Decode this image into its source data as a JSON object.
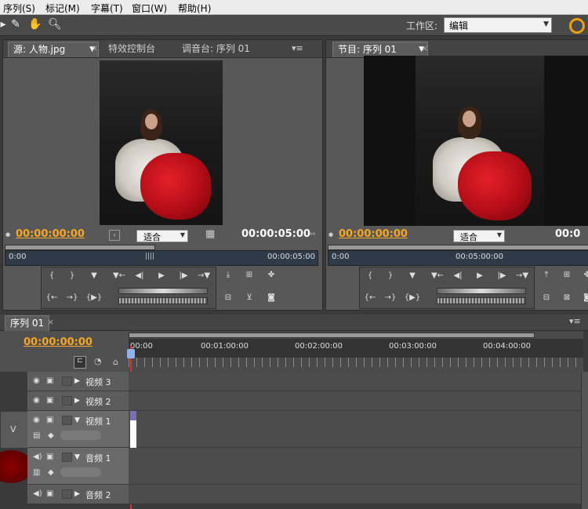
{
  "menu": [
    "序列(S)",
    "标记(M)",
    "字幕(T)",
    "窗口(W)",
    "帮助(H)"
  ],
  "toolbar": {
    "tools": [
      "select-arrow-icon",
      "pen-icon",
      "hand-icon",
      "zoom-icon"
    ],
    "workspace_label": "工作区:",
    "workspace_value": "编辑"
  },
  "source_panel": {
    "tabs": [
      "源: 人物.jpg",
      "特效控制台",
      "调音台: 序列 01"
    ],
    "timecode_left": "00:00:00:00",
    "fit": "适合",
    "timecode_right": "00:00:05:00",
    "ruler_start": "0:00",
    "ruler_end": "00:00:05:00"
  },
  "program_panel": {
    "tab": "节目: 序列 01",
    "timecode_left": "00:00:00:00",
    "fit": "适合",
    "timecode_right": "00:0",
    "ruler_start": "0:00",
    "ruler_mid": "00:05:00:00"
  },
  "timeline": {
    "tab": "序列 01",
    "timecode": "00:00:00:00",
    "ruler_labels": [
      "00:00",
      "00:01:00:00",
      "00:02:00:00",
      "00:03:00:00",
      "00:04:00:00"
    ],
    "target_label": "V",
    "tracks": [
      {
        "name": "视频 3"
      },
      {
        "name": "视频 2"
      },
      {
        "name": "视频 1"
      },
      {
        "name": "音频 1"
      },
      {
        "name": "音频 2"
      }
    ]
  },
  "colors": {
    "timecode": "#f5a623",
    "playhead": "#e03030",
    "accent": "#f0a000"
  }
}
